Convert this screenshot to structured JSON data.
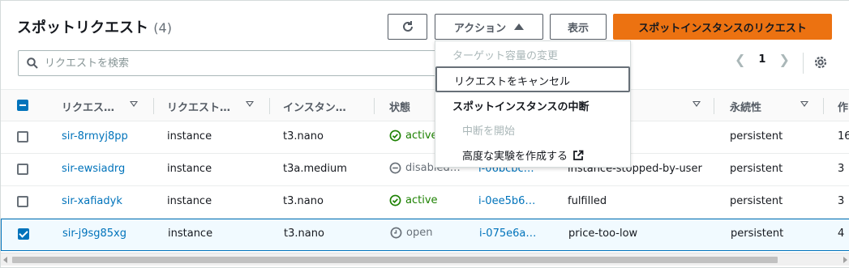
{
  "header": {
    "title": "スポットリクエスト",
    "count": "(4)",
    "actions_label": "アクション",
    "view_label": "表示",
    "primary_label": "スポットインスタンスのリクエスト"
  },
  "search": {
    "placeholder": "リクエストを検索"
  },
  "pagination": {
    "current_page": "1"
  },
  "actions_menu": {
    "items": [
      {
        "label": "ターゲット容量の変更",
        "state": "disabled"
      },
      {
        "label": "リクエストをキャンセル",
        "state": "hover"
      },
      {
        "label": "スポットインスタンスの中断",
        "state": "group"
      },
      {
        "label": "中断を開始",
        "state": "disabled"
      },
      {
        "label": "高度な実験を作成する",
        "state": "external"
      }
    ]
  },
  "table": {
    "columns": [
      "リクエス…",
      "リクエスト…",
      "インスタン…",
      "状態",
      "永続性",
      "作"
    ],
    "rows": [
      {
        "request_id": "sir-8rmyj8pp",
        "request_type": "instance",
        "instance_type": "t3.nano",
        "state": "active",
        "instance_id": "",
        "status": "",
        "persistence": "persistent",
        "created": "16",
        "selected": false
      },
      {
        "request_id": "sir-ewsiadrg",
        "request_type": "instance",
        "instance_type": "t3a.medium",
        "state": "disabled…",
        "instance_id": "i-06bcbc…",
        "status": "instance-stopped-by-user",
        "persistence": "persistent",
        "created": "3 ",
        "selected": false
      },
      {
        "request_id": "sir-xafiadyk",
        "request_type": "instance",
        "instance_type": "t3.nano",
        "state": "active",
        "instance_id": "i-0ee5b6…",
        "status": "fulfilled",
        "persistence": "persistent",
        "created": "3 ",
        "selected": false
      },
      {
        "request_id": "sir-j9sg85xg",
        "request_type": "instance",
        "instance_type": "t3.nano",
        "state": "open",
        "instance_id": "i-075e6a…",
        "status": "price-too-low",
        "persistence": "persistent",
        "created": "4 ",
        "selected": true
      }
    ]
  },
  "colors": {
    "primary": "#ec7211",
    "link": "#0073bb",
    "active": "#1d8102",
    "muted": "#687078"
  }
}
